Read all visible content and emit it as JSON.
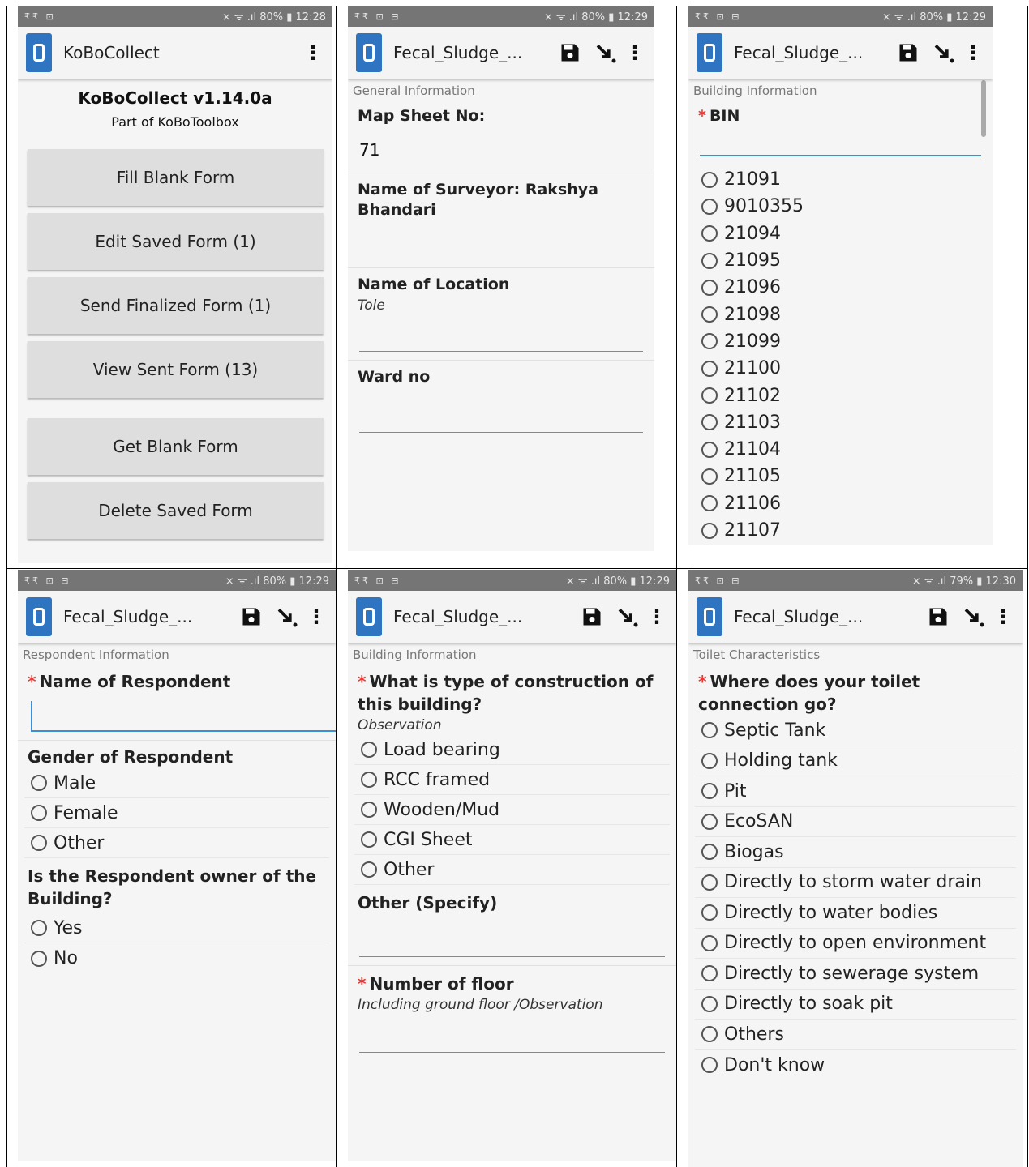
{
  "panels": {
    "p1": {
      "status": {
        "left": "₹₹ ⊡",
        "right": "⨯ ᯤ .ıl 80% ▮ 12:28"
      },
      "app_title": "KoBoCollect",
      "version": "KoBoCollect v1.14.0a",
      "part_of": "Part of KoBoToolbox",
      "buttons": [
        "Fill Blank Form",
        "Edit Saved Form (1)",
        "Send Finalized Form (1)",
        "View Sent Form (13)",
        "Get Blank Form",
        "Delete Saved Form"
      ]
    },
    "p2": {
      "status": {
        "left": "₹₹ ⊡ ⊟",
        "right": "⨯ ᯤ .ıl 80% ▮ 12:29"
      },
      "app_title": "Fecal_Sludge_...",
      "section": "General Information",
      "map_sheet_label": "Map Sheet No:",
      "map_sheet_value": "71",
      "surveyor_label": "Name of Surveyor: Rakshya Bhandari",
      "location_label": "Name of Location",
      "location_hint": "Tole",
      "ward_label": "Ward no"
    },
    "p3": {
      "status": {
        "left": "₹₹ ⊡ ⊟",
        "right": "⨯ ᯤ .ıl 80% ▮ 12:29"
      },
      "app_title": "Fecal_Sludge_...",
      "section": "Building Information",
      "bin_label": "BIN",
      "options": [
        "21091",
        "9010355",
        "21094",
        "21095",
        "21096",
        "21098",
        "21099",
        "21100",
        "21102",
        "21103",
        "21104",
        "21105",
        "21106",
        "21107"
      ]
    },
    "p4": {
      "status": {
        "left": "₹₹ ⊡ ⊟",
        "right": "⨯ ᯤ .ıl 80% ▮ 12:29"
      },
      "app_title": "Fecal_Sludge_...",
      "section": "Respondent Information",
      "name_label": "Name of Respondent",
      "gender_label": "Gender of Respondent",
      "gender_options": [
        "Male",
        "Female",
        "Other"
      ],
      "owner_label": "Is the Respondent owner of the Building?",
      "owner_options": [
        "Yes",
        "No"
      ]
    },
    "p5": {
      "status": {
        "left": "₹₹ ⊡ ⊟",
        "right": "⨯ ᯤ .ıl 80% ▮ 12:29"
      },
      "app_title": "Fecal_Sludge_...",
      "section": "Building Information",
      "type_label": "What is type of construction of this building?",
      "type_hint": "Observation",
      "type_options": [
        "Load bearing",
        "RCC framed",
        "Wooden/Mud",
        "CGI Sheet",
        "Other"
      ],
      "other_label": "Other (Specify)",
      "floor_label": "Number of floor",
      "floor_hint": "Including ground floor /Observation"
    },
    "p6": {
      "status": {
        "left": "₹₹ ⊡ ⊟",
        "right": "⨯ ᯤ .ıl 79% ▮ 12:30"
      },
      "app_title": "Fecal_Sludge_...",
      "section": "Toilet Characteristics",
      "toilet_label": "Where does your toilet connection go?",
      "toilet_options": [
        "Septic Tank",
        "Holding tank",
        "Pit",
        "EcoSAN",
        "Biogas",
        "Directly to storm water drain",
        "Directly to water bodies",
        "Directly to open environment",
        "Directly to sewerage system",
        "Directly to soak pit",
        "Others",
        "Don't know"
      ]
    }
  },
  "colors": {
    "accent": "#2f74c0",
    "status_bar": "#757575",
    "required": "#e53935"
  }
}
